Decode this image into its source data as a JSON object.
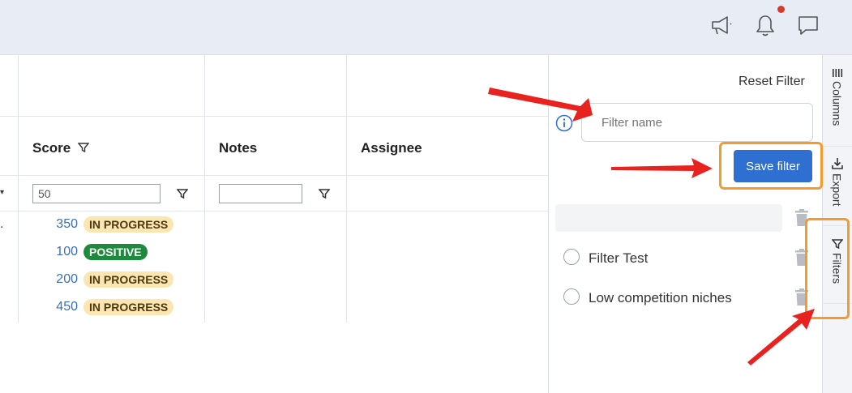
{
  "header": {
    "icons": [
      "megaphone-icon",
      "bell-icon",
      "chat-icon"
    ],
    "notification_dot_color": "#d93a2b"
  },
  "grid": {
    "columns": [
      {
        "label": "Score",
        "filter_value": "50"
      },
      {
        "label": "Notes",
        "filter_value": ""
      },
      {
        "label": "Assignee"
      }
    ],
    "row_marker": ".",
    "rows": [
      {
        "score": "350",
        "status": "IN PROGRESS"
      },
      {
        "score": "100",
        "status": "POSITIVE"
      },
      {
        "score": "200",
        "status": "IN PROGRESS"
      },
      {
        "score": "450",
        "status": "IN PROGRESS"
      }
    ]
  },
  "filter_panel": {
    "reset_label": "Reset Filter",
    "name_placeholder": "Filter name",
    "save_label": "Save filter",
    "saved_filters": [
      {
        "label": ""
      },
      {
        "label": "Filter Test"
      },
      {
        "label": "Low competition niches"
      }
    ]
  },
  "side_tabs": [
    {
      "label": "Columns"
    },
    {
      "label": "Export"
    },
    {
      "label": "Filters"
    }
  ],
  "colors": {
    "accent": "#2f6fd1",
    "highlight": "#f39b2b",
    "arrow": "#e8231f",
    "in_progress_bg": "#fbe5b0",
    "positive_bg": "#1f8a3d"
  }
}
